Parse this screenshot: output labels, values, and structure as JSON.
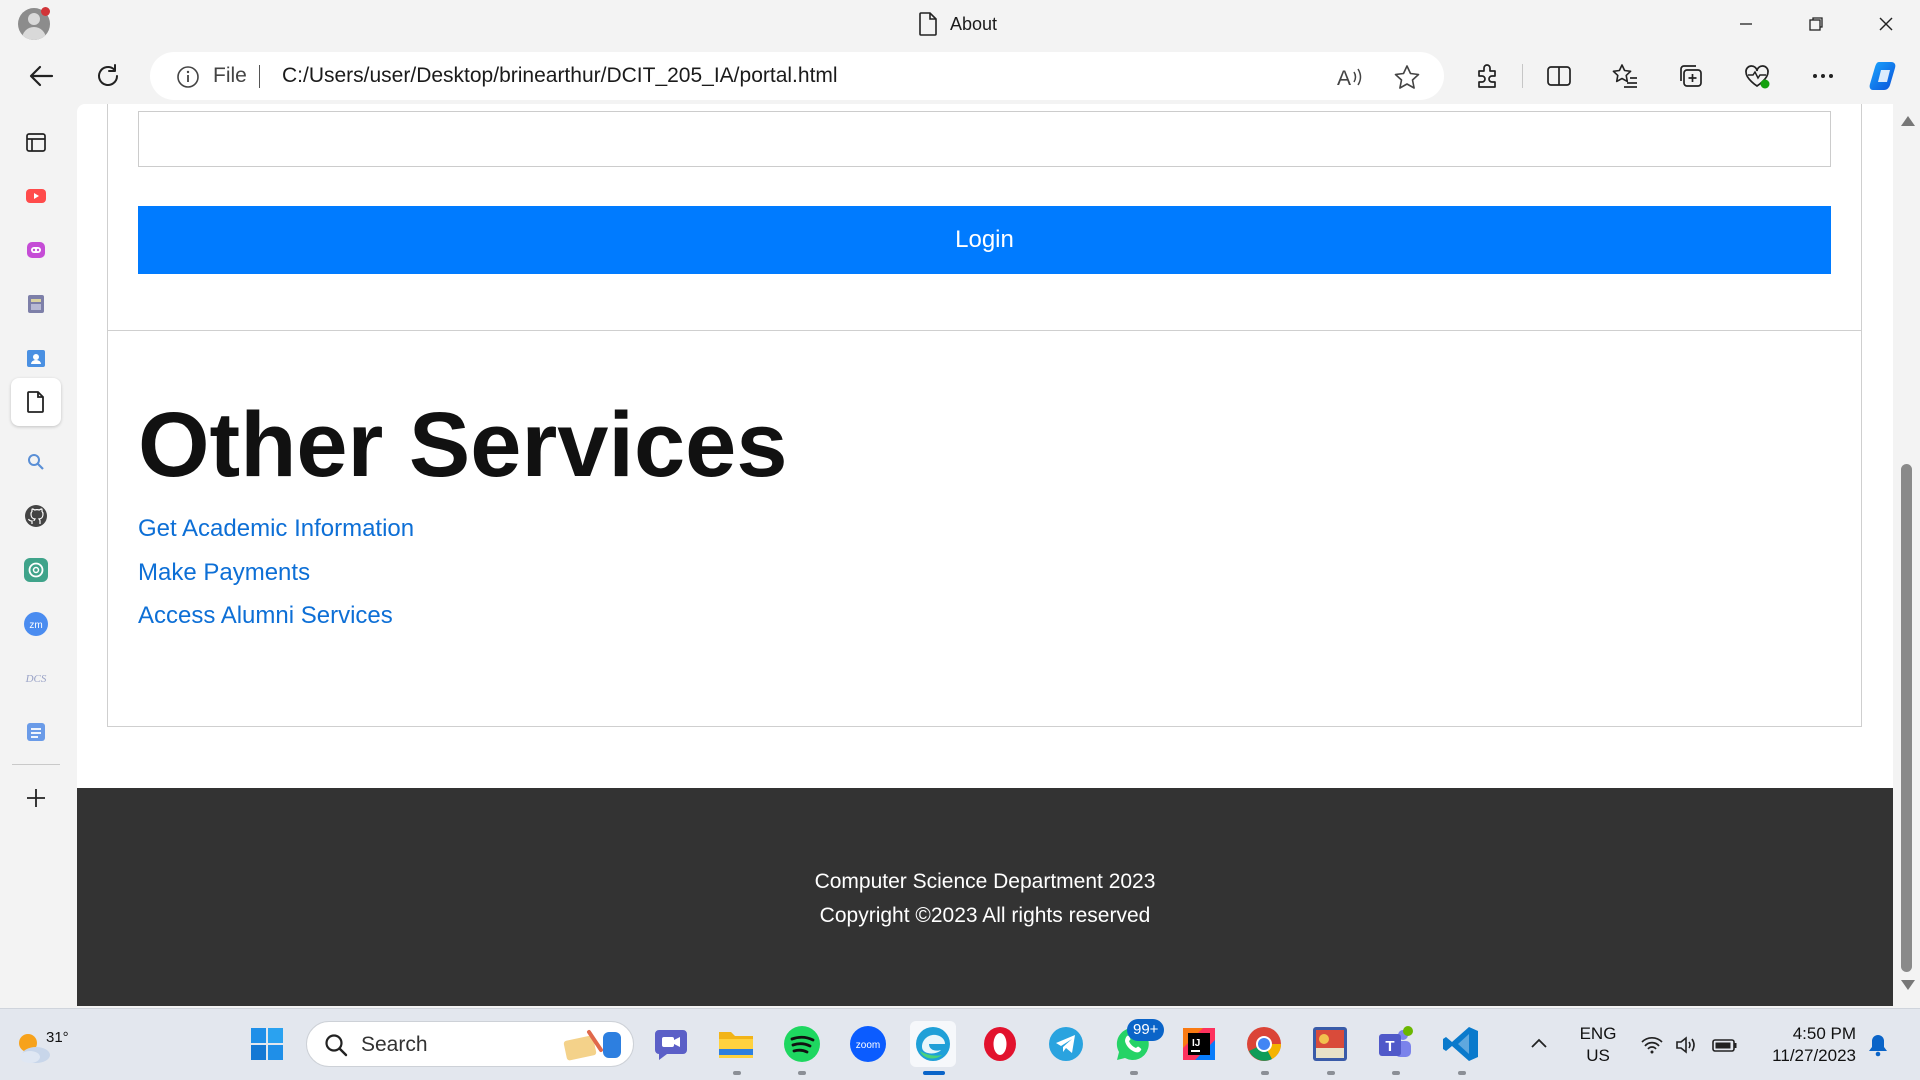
{
  "window": {
    "title": "About",
    "controls": [
      "minimize-icon",
      "restore-icon",
      "close-icon"
    ]
  },
  "address_bar": {
    "scheme_label": "File",
    "url": "C:/Users/user/Desktop/brinearthur/DCIT_205_IA/portal.html"
  },
  "sidebar": {
    "items": [
      "tab-actions-icon",
      "youtube-icon",
      "copilot-chat-icon",
      "university-icon",
      "contacts-icon",
      "page-icon",
      "search-icon",
      "github-icon",
      "chatgpt-icon",
      "zoom-icon",
      "dcit-icon",
      "notes-icon"
    ],
    "add_label": "+"
  },
  "page": {
    "login_button": "Login",
    "services_title": "Other Services",
    "links": [
      "Get Academic Information",
      "Make Payments",
      "Access Alumni Services"
    ],
    "footer": {
      "line1": "Computer Science Department 2023",
      "line2": "Copyright ©2023 All rights reserved"
    }
  },
  "colors": {
    "primary_button": "#007bff",
    "link": "#0d6fd6",
    "footer_bg": "#333333"
  },
  "taskbar": {
    "weather_temp": "31°",
    "search_placeholder": "Search",
    "notification_badge": "99+",
    "language_line1": "ENG",
    "language_line2": "US",
    "time": "4:50 PM",
    "date": "11/27/2023",
    "apps": [
      "start-icon",
      "search-icon",
      "meet-icon",
      "file-explorer-icon",
      "spotify-icon",
      "zoom-icon",
      "edge-icon",
      "opera-icon",
      "telegram-icon",
      "whatsapp-icon",
      "intellij-icon",
      "chrome-icon",
      "game-icon",
      "teams-icon",
      "vscode-icon"
    ]
  }
}
